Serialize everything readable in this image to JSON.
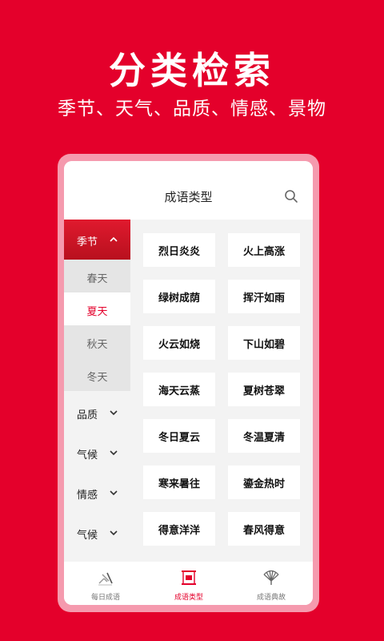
{
  "promo": {
    "title": "分类检索",
    "subtitle": "季节、天气、品质、情感、景物"
  },
  "header": {
    "title": "成语类型",
    "search_icon": "search-icon"
  },
  "sidebar": {
    "expanded": {
      "label": "季节",
      "icon": "chevron-up-icon",
      "subitems": [
        "春天",
        "夏天",
        "秋天",
        "冬天"
      ],
      "selected": "夏天"
    },
    "categories": [
      {
        "label": "品质",
        "icon": "chevron-down-icon"
      },
      {
        "label": "气候",
        "icon": "chevron-down-icon"
      },
      {
        "label": "情感",
        "icon": "chevron-down-icon"
      },
      {
        "label": "气候",
        "icon": "chevron-down-icon"
      }
    ]
  },
  "idioms": [
    "烈日炎炎",
    "火上高涨",
    "绿树成荫",
    "挥汗如雨",
    "火云如烧",
    "下山如碧",
    "海天云蒸",
    "夏树苍翠",
    "冬日夏云",
    "冬温夏清",
    "寒来暑往",
    "鎏金热时",
    "得意洋洋",
    "春风得意"
  ],
  "tabbar": {
    "tabs": [
      {
        "label": "每日成语",
        "icon": "brush-icon",
        "active": false
      },
      {
        "label": "成语类型",
        "icon": "scroll-icon",
        "active": true
      },
      {
        "label": "成语典故",
        "icon": "fan-icon",
        "active": false
      }
    ]
  },
  "colors": {
    "brand_red": "#E4002B",
    "frame_pink": "#F59AAE",
    "active_text": "#E4002B"
  }
}
